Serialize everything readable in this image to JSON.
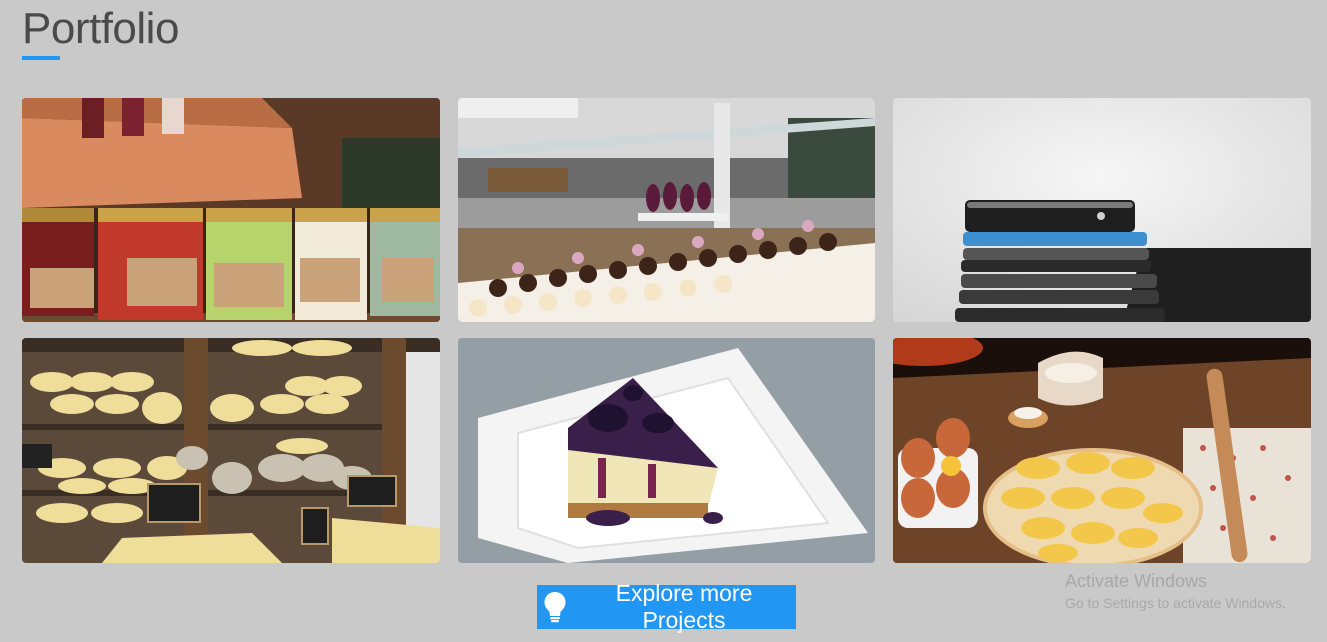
{
  "section": {
    "title": "Portfolio",
    "accent_color": "#2196f3"
  },
  "portfolio": {
    "items": [
      {
        "subject": "candle-jars-photo"
      },
      {
        "subject": "pastry-display-photo"
      },
      {
        "subject": "stacked-smartphones-photo"
      },
      {
        "subject": "cheese-shelves-photo"
      },
      {
        "subject": "cheesecake-slice-photo"
      },
      {
        "subject": "dumplings-baking-photo"
      }
    ]
  },
  "cta": {
    "label": "Explore more Projects",
    "icon": "lightbulb-icon"
  },
  "watermark": {
    "title": "Activate Windows",
    "subtitle": "Go to Settings to activate Windows."
  }
}
